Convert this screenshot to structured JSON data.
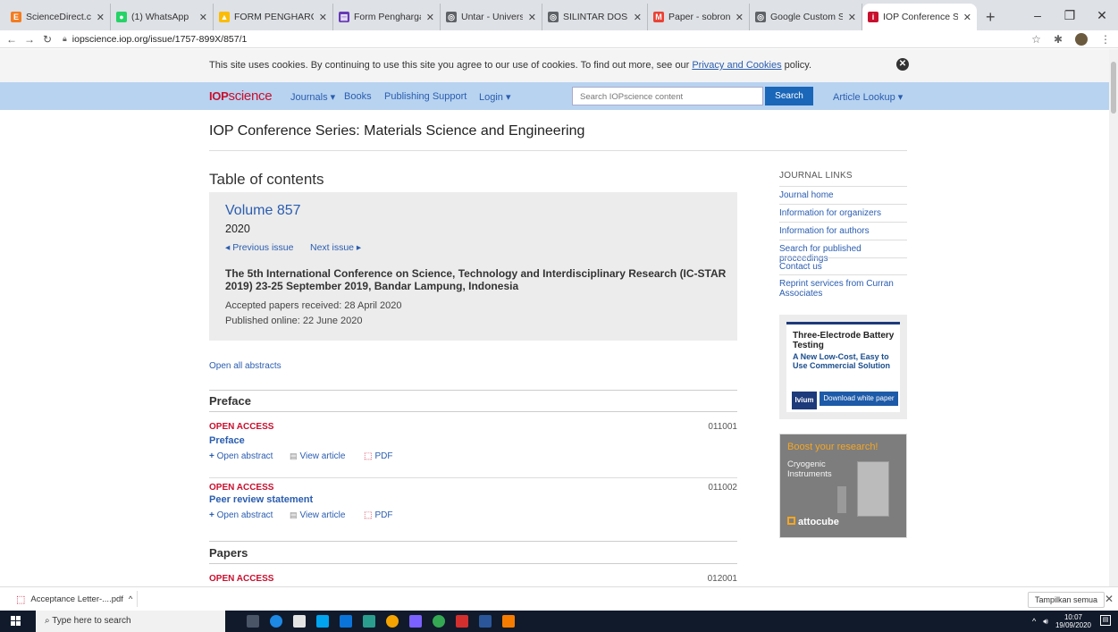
{
  "browser": {
    "tabs": [
      {
        "label": "ScienceDirect.com | Sci",
        "fav_color": "#f47c20",
        "fav_glyph": "E"
      },
      {
        "label": "(1) WhatsApp",
        "fav_color": "#25d366",
        "fav_glyph": "●"
      },
      {
        "label": "FORM PENGHARGAAN",
        "fav_color": "#fbbc04",
        "fav_glyph": "▲"
      },
      {
        "label": "Form Penghargaan Bid",
        "fav_color": "#673ab7",
        "fav_glyph": "▤"
      },
      {
        "label": "Untar - Universitas Taru",
        "fav_color": "#5f6368",
        "fav_glyph": "◎"
      },
      {
        "label": "SILINTAR DOSEN",
        "fav_color": "#5f6368",
        "fav_glyph": "◎"
      },
      {
        "label": "Paper - sobronl@ft.unt",
        "fav_color": "#ea4335",
        "fav_glyph": "M"
      },
      {
        "label": "Google Custom Search",
        "fav_color": "#5f6368",
        "fav_glyph": "◎"
      },
      {
        "label": "IOP Conference Series",
        "fav_color": "#c8102e",
        "fav_glyph": "i"
      }
    ],
    "url": "iopscience.iop.org/issue/1757-899X/857/1"
  },
  "cookie": {
    "text": "This site uses cookies. By continuing to use this site you agree to our use of cookies. To find out more, see our",
    "link": "Privacy and Cookies",
    "suffix": "policy."
  },
  "nav": {
    "logo_iop": "IOP",
    "logo_science": "science",
    "journals": "Journals ▾",
    "books": "Books",
    "publishing_support": "Publishing Support",
    "login": "Login ▾",
    "search_placeholder": "Search IOPscience content",
    "search_button": "Search",
    "article_lookup": "Article Lookup ▾"
  },
  "journal_title": "IOP Conference Series: Materials Science and Engineering",
  "toc": {
    "heading": "Table of contents",
    "volume": "Volume 857",
    "year": "2020",
    "previous": "◂ Previous issue",
    "next": "Next issue ▸",
    "conference": "The 5th International Conference on Science, Technology and Interdisciplinary Research (IC-STAR 2019) 23-25 September 2019, Bandar Lampung, Indonesia",
    "accepted": "Accepted papers received: 28 April 2020",
    "published": "Published online: 22 June 2020",
    "open_all": "Open all abstracts"
  },
  "sections": {
    "preface": "Preface",
    "papers": "Papers"
  },
  "articles": [
    {
      "access": "OPEN ACCESS",
      "code": "011001",
      "title": "Preface",
      "open_abstract": "Open abstract",
      "view_article": "View article",
      "pdf": "PDF"
    },
    {
      "access": "OPEN ACCESS",
      "code": "011002",
      "title": "Peer review statement",
      "open_abstract": "Open abstract",
      "view_article": "View article",
      "pdf": "PDF"
    },
    {
      "access": "OPEN ACCESS",
      "code": "012001"
    }
  ],
  "sidebar": {
    "heading": "JOURNAL LINKS",
    "links": [
      "Journal home",
      "Information for organizers",
      "Information for authors",
      "Search for published proceedings",
      "Contact us",
      "Reprint services from Curran Associates"
    ]
  },
  "ad1": {
    "title": "Three-Electrode Battery Testing",
    "subtitle": "A New Low-Cost, Easy to Use Commercial Solution",
    "logo": "Ivium",
    "button": "Download white paper"
  },
  "ad2": {
    "headline": "Boost your research!",
    "text": "Cryogenic Instruments",
    "brand": "attocube"
  },
  "downloads": {
    "file": "Acceptance Letter-....pdf",
    "show_all": "Tampilkan semua"
  },
  "taskbar": {
    "search_placeholder": "Type here to search",
    "time": "10:07",
    "date": "19/09/2020"
  }
}
